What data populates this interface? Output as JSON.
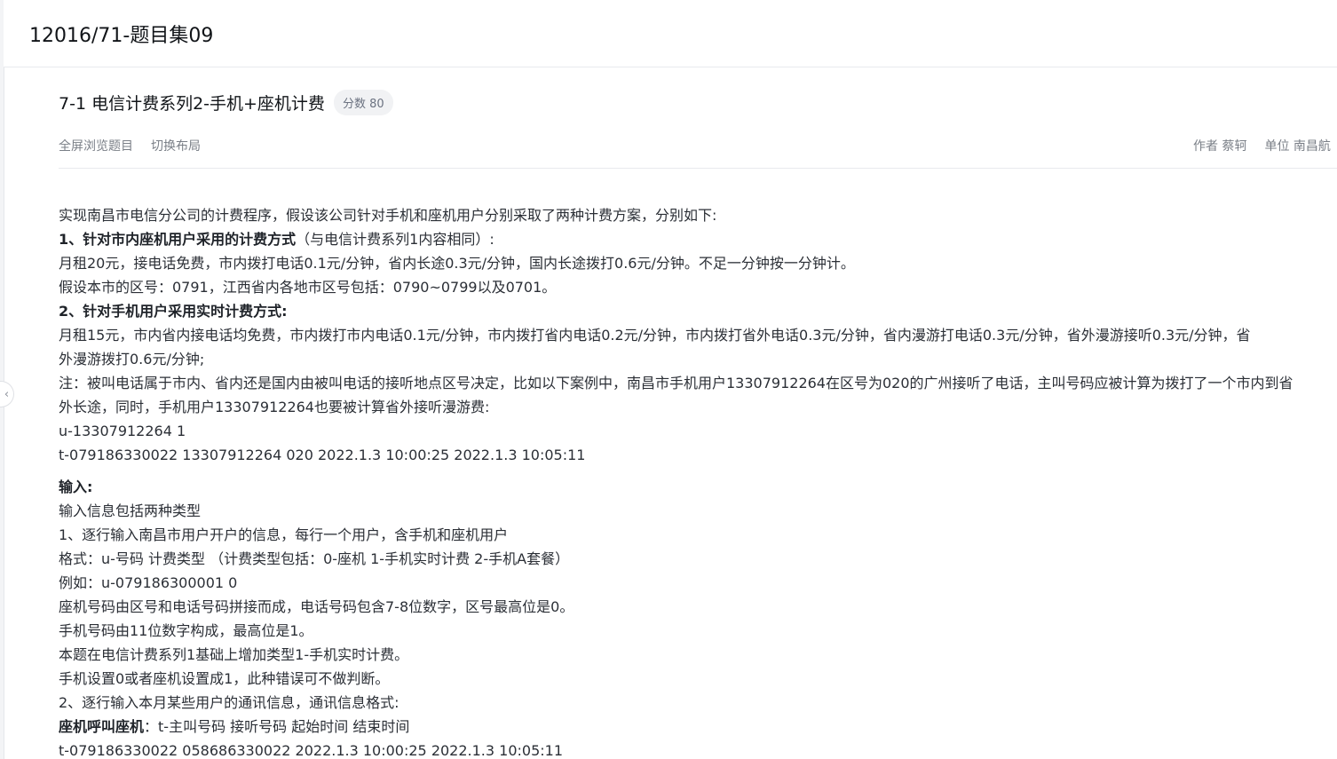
{
  "header": {
    "set_title": "12016/71-题目集09"
  },
  "problem": {
    "title": "7-1 电信计费系列2-手机+座机计费",
    "score_label": "分数 80",
    "actions": {
      "fullscreen": "全屏浏览题目",
      "switch_layout": "切换布局"
    },
    "meta": {
      "author": "作者 蔡轲",
      "unit": "单位 南昌航"
    }
  },
  "content": {
    "intro": "实现南昌市电信分公司的计费程序，假设该公司针对手机和座机用户分别采取了两种计费方案，分别如下:",
    "sec1_bold": "1、针对市内座机用户采用的计费方式",
    "sec1_rest": "（与电信计费系列1内容相同）:",
    "line_landline_rates": "月租20元，接电话免费，市内拨打电话0.1元/分钟，省内长途0.3元/分钟，国内长途拨打0.6元/分钟。不足一分钟按一分钟计。",
    "line_area_codes": "假设本市的区号：0791，江西省内各地市区号包括：0790~0799以及0701。",
    "sec2_bold": "2、针对手机用户采用实时计费方式:",
    "line_mobile_rates_1": "月租15元，市内省内接电话均免费，市内拨打市内电话0.1元/分钟，市内拨打省内电话0.2元/分钟，市内拨打省外电话0.3元/分钟，省内漫游打电话0.3元/分钟，省外漫游接听0.3元/分钟，省",
    "line_mobile_rates_2": "外漫游拨打0.6元/分钟;",
    "line_note_1": "注：被叫电话属于市内、省内还是国内由被叫电话的接听地点区号决定，比如以下案例中，南昌市手机用户13307912264在区号为020的广州接听了电话，主叫号码应被计算为拨打了一个市内到省",
    "line_note_2": "外长途，同时，手机用户13307912264也要被计算省外接听漫游费:",
    "example_u": "u-13307912264 1",
    "example_t": "t-079186330022 13307912264 020 2022.1.3 10:00:25 2022.1.3 10:05:11",
    "input_heading": "输入:",
    "input_line_1": "输入信息包括两种类型",
    "input_line_2": "1、逐行输入南昌市用户开户的信息，每行一个用户，含手机和座机用户",
    "input_line_3": "格式：u-号码 计费类型 （计费类型包括：0-座机 1-手机实时计费 2-手机A套餐）",
    "input_line_4": "例如：u-079186300001 0",
    "input_line_5": "座机号码由区号和电话号码拼接而成，电话号码包含7-8位数字，区号最高位是0。",
    "input_line_6": "手机号码由11位数字构成，最高位是1。",
    "input_line_7": "本题在电信计费系列1基础上增加类型1-手机实时计费。",
    "input_line_8": "手机设置0或者座机设置成1，此种错误可不做判断。",
    "input_line_9": "2、逐行输入本月某些用户的通讯信息，通讯信息格式:",
    "call_bold": "座机呼叫座机",
    "call_rest": "：t-主叫号码 接听号码 起始时间 结束时间",
    "call_example": "t-079186330022 058686330022 2022.1.3 10:00:25 2022.1.3 10:05:11"
  }
}
